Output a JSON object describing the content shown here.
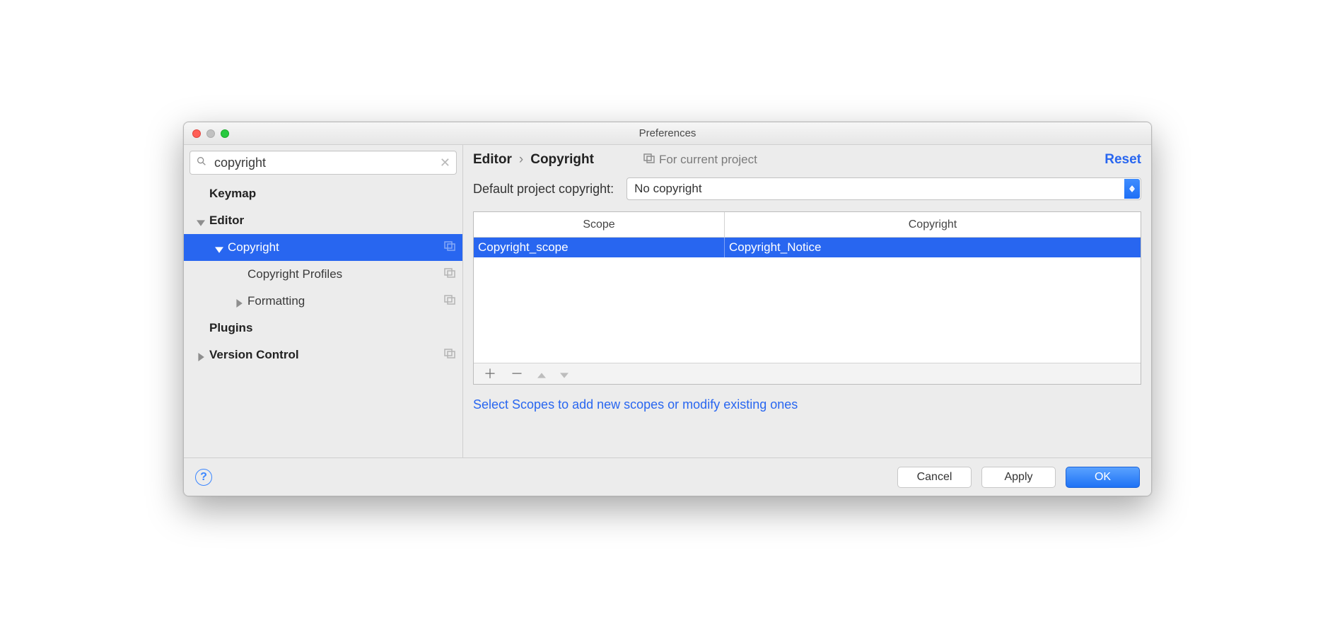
{
  "window": {
    "title": "Preferences"
  },
  "search": {
    "value": "copyright"
  },
  "sidebar": {
    "items": [
      {
        "label": "Keymap"
      },
      {
        "label": "Editor"
      },
      {
        "label": "Copyright"
      },
      {
        "label": "Copyright Profiles"
      },
      {
        "label": "Formatting"
      },
      {
        "label": "Plugins"
      },
      {
        "label": "Version Control"
      }
    ]
  },
  "breadcrumb": {
    "root": "Editor",
    "leaf": "Copyright"
  },
  "scope_hint": "For current project",
  "reset_label": "Reset",
  "default_copyright": {
    "label": "Default project copyright:",
    "value": "No copyright"
  },
  "table": {
    "columns": [
      "Scope",
      "Copyright"
    ],
    "rows": [
      {
        "scope": "Copyright_scope",
        "copyright": "Copyright_Notice"
      }
    ]
  },
  "hint_link": "Select Scopes to add new scopes or modify existing ones",
  "footer": {
    "cancel": "Cancel",
    "apply": "Apply",
    "ok": "OK"
  }
}
